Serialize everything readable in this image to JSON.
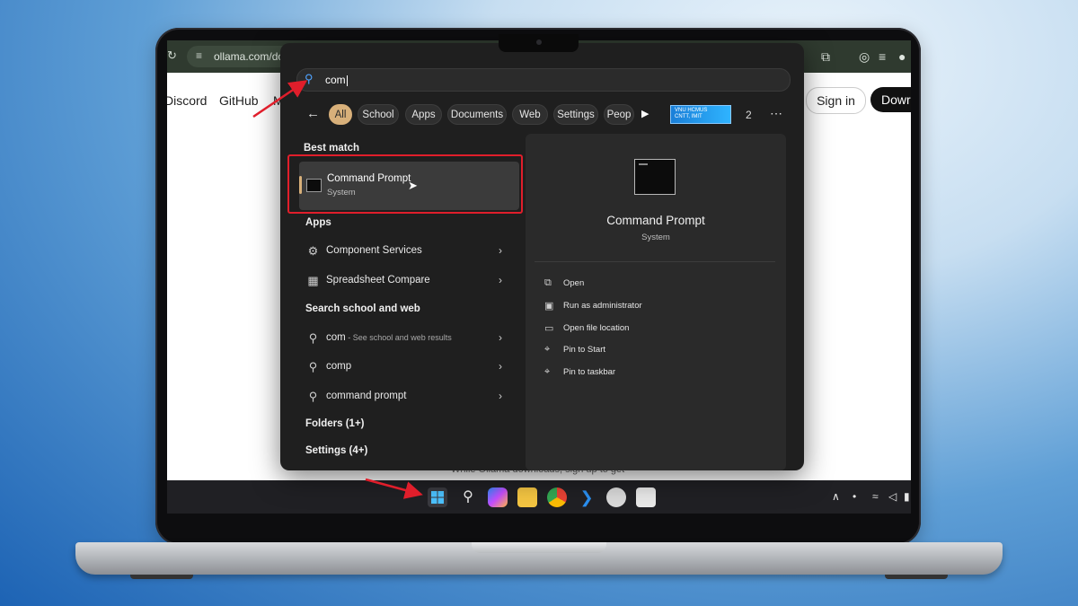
{
  "browser": {
    "url": "ollama.com/dov",
    "nav_links": [
      "Discord",
      "GitHub",
      "M"
    ],
    "signin_label": "Sign in",
    "download_label": "Dowr",
    "page_fragment": "While Ollama downloads, sign up to get"
  },
  "search": {
    "query": "com",
    "filters": [
      "All",
      "School",
      "Apps",
      "Documents",
      "Web",
      "Settings",
      "Peop"
    ],
    "active_filter": "All",
    "promo_text": "VNU HCMUS",
    "promo_subtext": "CNTT, IMIT",
    "count": "2"
  },
  "results": {
    "best_match_heading": "Best match",
    "best_match": {
      "title": "Command Prompt",
      "subtitle": "System"
    },
    "apps_heading": "Apps",
    "apps": [
      {
        "label": "Component Services",
        "icon": "component-services-icon"
      },
      {
        "label": "Spreadsheet Compare",
        "icon": "spreadsheet-icon"
      }
    ],
    "web_heading": "Search school and web",
    "web": [
      {
        "label": "com",
        "sub": " - See school and web results"
      },
      {
        "label": "comp",
        "sub": ""
      },
      {
        "label": "command prompt",
        "sub": ""
      }
    ],
    "folders_heading": "Folders (1+)",
    "settings_heading": "Settings (4+)"
  },
  "details": {
    "title": "Command Prompt",
    "subtitle": "System",
    "actions": [
      {
        "label": "Open",
        "icon": "open-external-icon"
      },
      {
        "label": "Run as administrator",
        "icon": "shield-admin-icon"
      },
      {
        "label": "Open file location",
        "icon": "folder-icon"
      },
      {
        "label": "Pin to Start",
        "icon": "pin-icon"
      },
      {
        "label": "Pin to taskbar",
        "icon": "pin-icon"
      }
    ]
  },
  "taskbar": {
    "apps": [
      "start",
      "search",
      "copilot",
      "file-explorer",
      "chrome",
      "vscode",
      "clock",
      "snipping"
    ]
  },
  "colors": {
    "accent": "#d8b07a",
    "highlight_box": "#e01e2b",
    "panel_bg": "#1f1f1f"
  }
}
